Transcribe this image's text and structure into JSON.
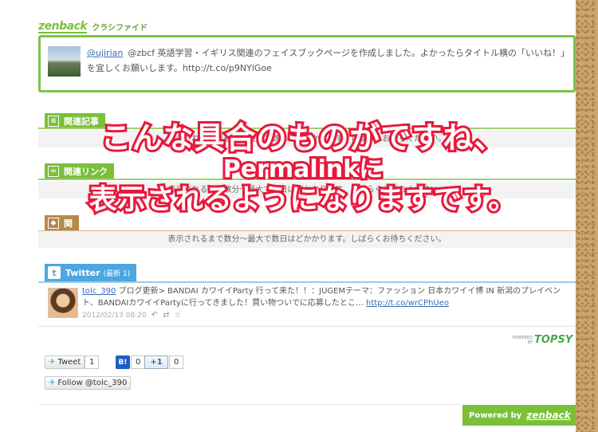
{
  "colors": {
    "green": "#7bbf3a",
    "twitter_blue": "#4da6e0",
    "caption_red": "#e8193c",
    "link": "#3b6cb5"
  },
  "header": {
    "logo": "zenback",
    "subtitle": "クラシファイド"
  },
  "post": {
    "user": "@ujirian",
    "text": "@zbcf 英語学習・イギリス関連のフェイスブックページを作成しました。よかったらタイトル横の「いいね！」を宜しくお願いします。http://t.co/p9NYlGoe"
  },
  "sections": [
    {
      "icon": "document-icon",
      "title": "関連記事",
      "body": "表示されるまで数分～最大で数日はどかかります。しばらくお待ちください。"
    },
    {
      "icon": "link-icon",
      "title": "関連リンク",
      "body": "表示されるまで数分～最大で数日はどかかります。しばらくお待ちください。"
    },
    {
      "icon": "tag-icon",
      "title": "関",
      "body": "表示されるまで数分～最大で数日はどかかります。しばらくお待ちください。"
    }
  ],
  "twitter": {
    "title": "Twitter",
    "count_label": "(最新 1)",
    "tweet": {
      "user": "tolc_390",
      "text": "ブログ更新> BANDAI カワイイParty 行って来た！！：JUGEMテーマ：ファッション 日本カワイイ博 IN 新潟のプレイベント、BANDAIカワイイPartyに行ってきました！買い物ついでに応募したとこ…",
      "link": "http://t.co/wrCPhUeo",
      "timestamp": "2012/02/13 08:20"
    }
  },
  "topsy": {
    "powered_by": "POWERED BY",
    "name": "TOPSY"
  },
  "social": {
    "tweet_label": "Tweet",
    "tweet_count": "1",
    "hatena_label": "B!",
    "hatena_count": "0",
    "gplus_label": "+1",
    "gplus_count": "0",
    "follow_label": "Follow @tolc_390"
  },
  "footer": {
    "powered_label": "Powered by",
    "logo": "zenback"
  },
  "caption": {
    "line1": "こんな具合のものがですね、",
    "line2": "Permalinkに",
    "line3": "表示されるようになりますです。"
  }
}
